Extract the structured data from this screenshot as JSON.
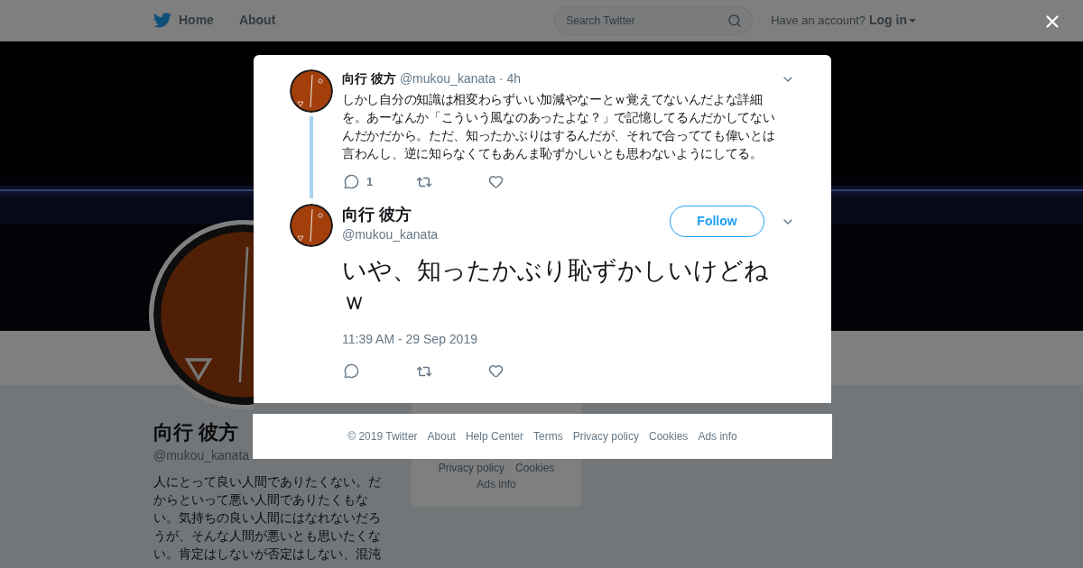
{
  "header": {
    "nav": [
      "Home",
      "About"
    ],
    "search": {
      "placeholder": "Search Twitter"
    },
    "account_prompt": "Have an account?",
    "login": "Log in"
  },
  "profile": {
    "name": "向行 彼方",
    "handle": "@mukou_kanata",
    "bio": "人にとって良い人間でありたくない。だからといって悪い人間でありたくもない。気持ちの良い人間にはなれないだろうが、そんな人間が悪いとも思いたくない。肯定はしないが否定はしない、混沌",
    "side_footer": [
      "Privacy policy",
      "Cookies",
      "Ads info"
    ]
  },
  "modal": {
    "parent_tweet": {
      "name": "向行 彼方",
      "handle": "@mukou_kanata",
      "age": "· 4h",
      "text": "しかし自分の知識は相変わらずいい加減やなーとｗ覚えてないんだよな詳細を。あーなんか「こういう風なのあったよな？」で記憶してるんだかしてないんだかだから。ただ、知ったかぶりはするんだが、それで合ってても偉いとは言わんし、逆に知らなくてもあんま恥ずかしいとも思わないようにしてる。",
      "reply_count": "1"
    },
    "main_tweet": {
      "name": "向行 彼方",
      "handle": "@mukou_kanata",
      "follow": "Follow",
      "text": "いや、知ったかぶり恥ずかしいけどねｗ",
      "timestamp": "11:39 AM - 29 Sep 2019"
    },
    "footer": [
      "© 2019 Twitter",
      "About",
      "Help Center",
      "Terms",
      "Privacy policy",
      "Cookies",
      "Ads info"
    ]
  }
}
